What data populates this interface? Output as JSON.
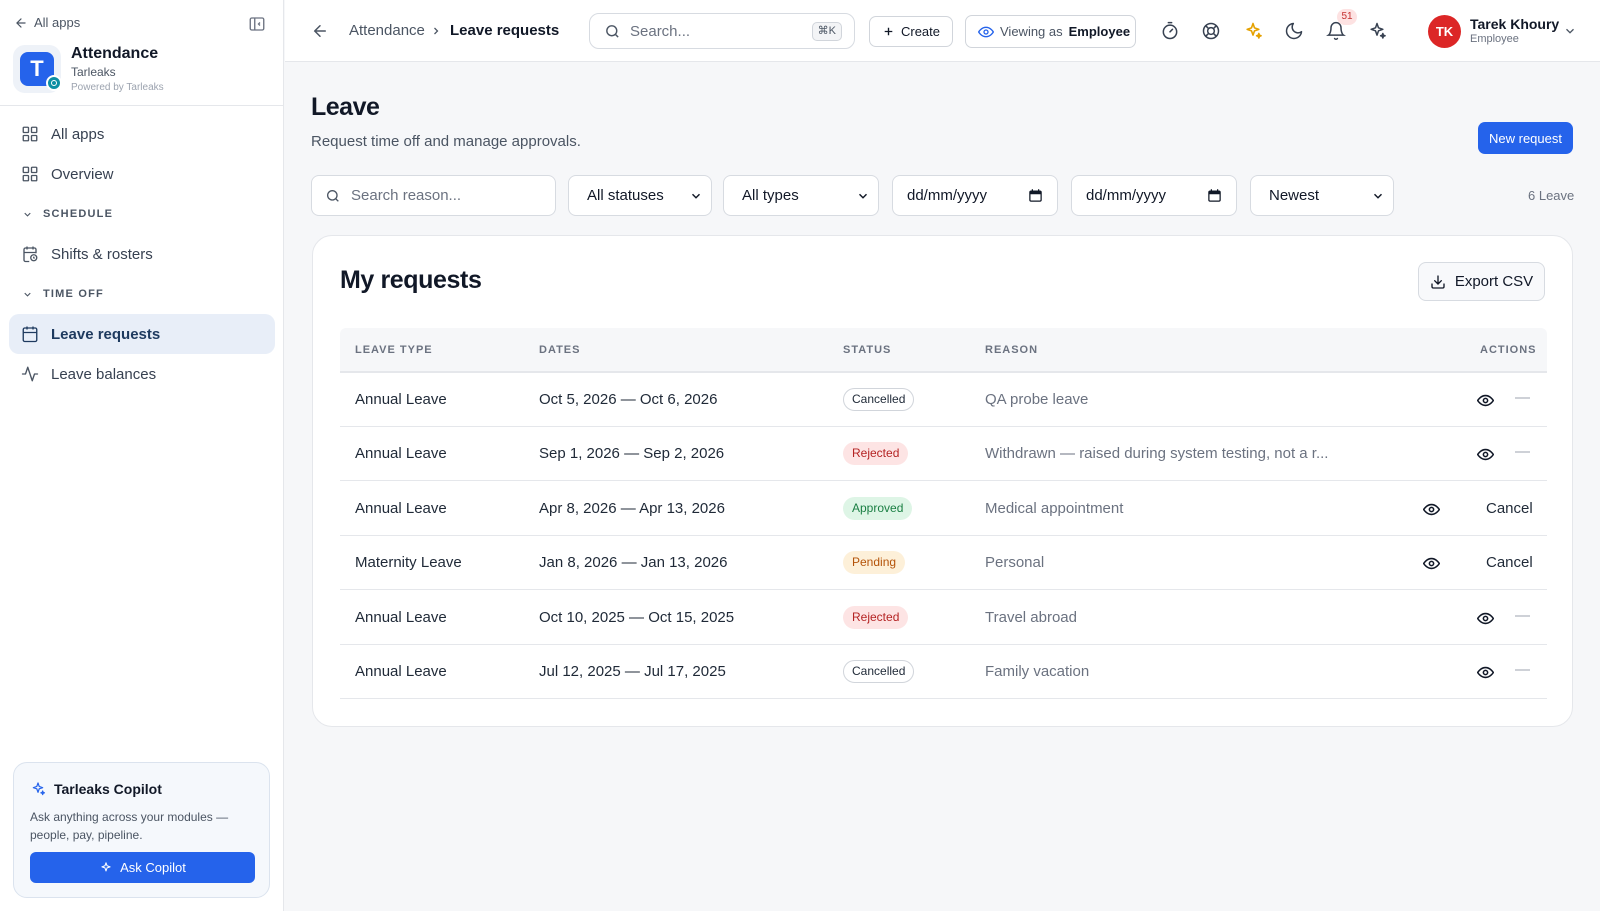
{
  "sidebar": {
    "all_apps_link": "All apps",
    "app": {
      "name": "Attendance",
      "org": "Tarleaks",
      "powered_by": "Powered by Tarleaks",
      "logo_letter": "T"
    },
    "nav": {
      "all_apps": "All apps",
      "overview": "Overview",
      "schedule_section": "SCHEDULE",
      "shifts": "Shifts & rosters",
      "timeoff_section": "TIME OFF",
      "leave_requests": "Leave requests",
      "leave_balances": "Leave balances"
    },
    "copilot": {
      "title": "Tarleaks Copilot",
      "description": "Ask anything across your modules — people, pay, pipeline.",
      "button": "Ask Copilot"
    }
  },
  "topbar": {
    "breadcrumb": [
      "Attendance",
      "Leave requests"
    ],
    "search_placeholder": "Search...",
    "search_shortcut": "⌘K",
    "create_label": "Create",
    "viewing_as_label": "Viewing as",
    "viewing_as_role": "Employee",
    "notification_count": "51",
    "user": {
      "initials": "TK",
      "name": "Tarek Khoury",
      "role": "Employee"
    }
  },
  "page": {
    "title": "Leave",
    "subtitle": "Request time off and manage approvals.",
    "new_request_label": "New request"
  },
  "filters": {
    "search_placeholder": "Search reason...",
    "status_value": "All statuses",
    "type_value": "All types",
    "date_from_placeholder": "dd/mm/yyyy",
    "date_to_placeholder": "dd/mm/yyyy",
    "sort_value": "Newest",
    "count_label": "6 Leave"
  },
  "requests": {
    "title": "My requests",
    "export_label": "Export CSV",
    "columns": [
      "LEAVE TYPE",
      "DATES",
      "STATUS",
      "REASON",
      "ACTIONS"
    ],
    "rows": [
      {
        "type": "Annual Leave",
        "dates": "Oct 5, 2026 — Oct 6, 2026",
        "status": "Cancelled",
        "reason": "QA probe leave",
        "action": "—"
      },
      {
        "type": "Annual Leave",
        "dates": "Sep 1, 2026 — Sep 2, 2026",
        "status": "Rejected",
        "reason": "Withdrawn — raised during system testing, not a r...",
        "action": "—"
      },
      {
        "type": "Annual Leave",
        "dates": "Apr 8, 2026 — Apr 13, 2026",
        "status": "Approved",
        "reason": "Medical appointment",
        "action": "Cancel"
      },
      {
        "type": "Maternity Leave",
        "dates": "Jan 8, 2026 — Jan 13, 2026",
        "status": "Pending",
        "reason": "Personal",
        "action": "Cancel"
      },
      {
        "type": "Annual Leave",
        "dates": "Oct 10, 2025 — Oct 15, 2025",
        "status": "Rejected",
        "reason": "Travel abroad",
        "action": "—"
      },
      {
        "type": "Annual Leave",
        "dates": "Jul 12, 2025 — Jul 17, 2025",
        "status": "Cancelled",
        "reason": "Family vacation",
        "action": "—"
      }
    ]
  },
  "colors": {
    "accent": "#2563eb",
    "avatar": "#dc2626",
    "copilot_star": "#e5a100"
  }
}
